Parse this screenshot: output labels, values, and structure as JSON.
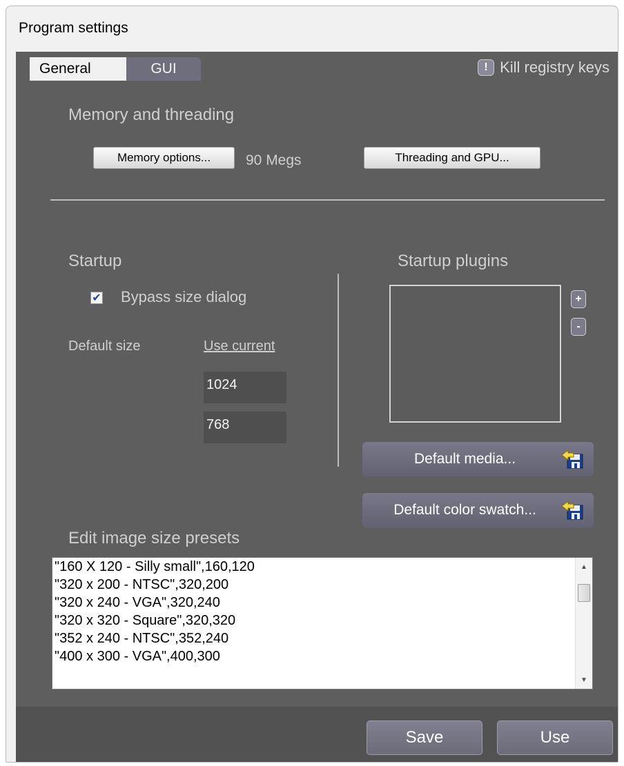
{
  "window": {
    "title": "Program settings"
  },
  "tabs": [
    {
      "label": "General"
    },
    {
      "label": "GUI"
    }
  ],
  "kill_registry": {
    "icon": "exclamation-icon",
    "icon_glyph": "!",
    "label": "Kill registry keys"
  },
  "memory": {
    "section_title": "Memory and threading",
    "memory_button": "Memory options...",
    "memory_value": "90 Megs",
    "threading_button": "Threading and GPU..."
  },
  "startup": {
    "section_title": "Startup",
    "bypass_label": "Bypass size dialog",
    "bypass_checked": true,
    "check_glyph": "✔",
    "default_size_label": "Default size",
    "use_current_link": "Use current",
    "width": "1024",
    "height": "768"
  },
  "plugins": {
    "section_title": "Startup plugins",
    "add_glyph": "+",
    "remove_glyph": "-"
  },
  "media_buttons": {
    "default_media": "Default media...",
    "default_swatch": "Default color swatch...",
    "icon": "open-folder-icon"
  },
  "presets": {
    "section_title": "Edit image size presets",
    "items": [
      "\"160 X 120 - Silly small\",160,120",
      "\"320 x 200 - NTSC\",320,200",
      "\"320 x 240 -  VGA\",320,240",
      "\"320 x 320 - Square\",320,320",
      "\"352 x 240 - NTSC\",352,240",
      "\"400 x 300 - VGA\",400,300"
    ]
  },
  "footer": {
    "save": "Save",
    "use": "Use"
  },
  "colors": {
    "panel": "#5e5e5e",
    "button_dark": "#6e6e7c",
    "text_light": "#cfcfcf"
  }
}
